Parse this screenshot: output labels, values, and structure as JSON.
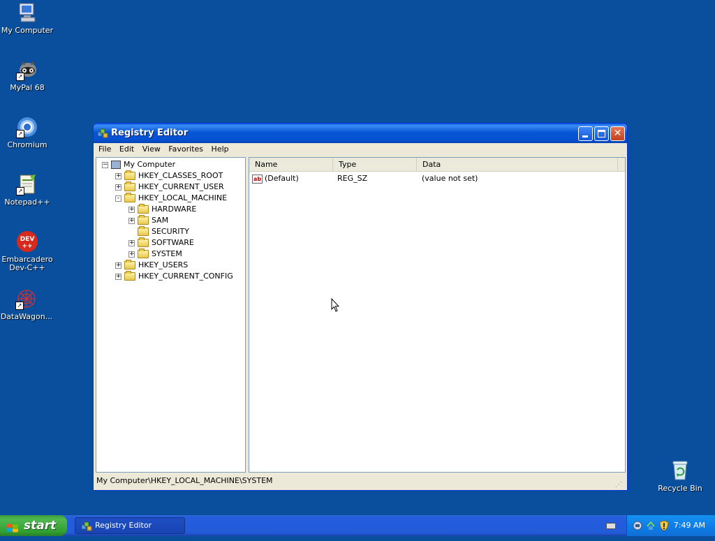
{
  "desktop": {
    "icons": [
      {
        "label": "My Computer",
        "icon": "my-computer-icon"
      },
      {
        "label": "MyPal 68",
        "icon": "mypal-icon"
      },
      {
        "label": "Chromium",
        "icon": "chromium-icon"
      },
      {
        "label": "Notepad++",
        "icon": "notepadpp-icon"
      },
      {
        "label": "Embarcadero Dev-C++",
        "icon": "devcpp-icon"
      },
      {
        "label": "DataWagon...",
        "icon": "datawagon-icon"
      },
      {
        "label": "Recycle Bin",
        "icon": "recycle-bin-icon"
      }
    ]
  },
  "window": {
    "title": "Registry Editor",
    "menu": [
      "File",
      "Edit",
      "View",
      "Favorites",
      "Help"
    ],
    "tree": {
      "root": "My Computer",
      "nodes": [
        {
          "label": "HKEY_CLASSES_ROOT",
          "expander": "+"
        },
        {
          "label": "HKEY_CURRENT_USER",
          "expander": "+"
        },
        {
          "label": "HKEY_LOCAL_MACHINE",
          "expander": "-"
        },
        {
          "label": "HARDWARE",
          "expander": "+"
        },
        {
          "label": "SAM",
          "expander": "+"
        },
        {
          "label": "SECURITY",
          "expander": ""
        },
        {
          "label": "SOFTWARE",
          "expander": "+"
        },
        {
          "label": "SYSTEM",
          "expander": "+"
        },
        {
          "label": "HKEY_USERS",
          "expander": "+"
        },
        {
          "label": "HKEY_CURRENT_CONFIG",
          "expander": "+"
        }
      ]
    },
    "list": {
      "columns": [
        "Name",
        "Type",
        "Data"
      ],
      "rows": [
        {
          "name": "(Default)",
          "type": "REG_SZ",
          "data": "(value not set)"
        }
      ]
    },
    "status": "My Computer\\HKEY_LOCAL_MACHINE\\SYSTEM"
  },
  "taskbar": {
    "start_label": "start",
    "task_label": "Registry Editor",
    "clock": "7:49 AM"
  },
  "colors": {
    "desktop": "#0a4f9e",
    "titlebar": "#0756d6",
    "taskbar": "#245edc",
    "start": "#3c9a3c"
  }
}
